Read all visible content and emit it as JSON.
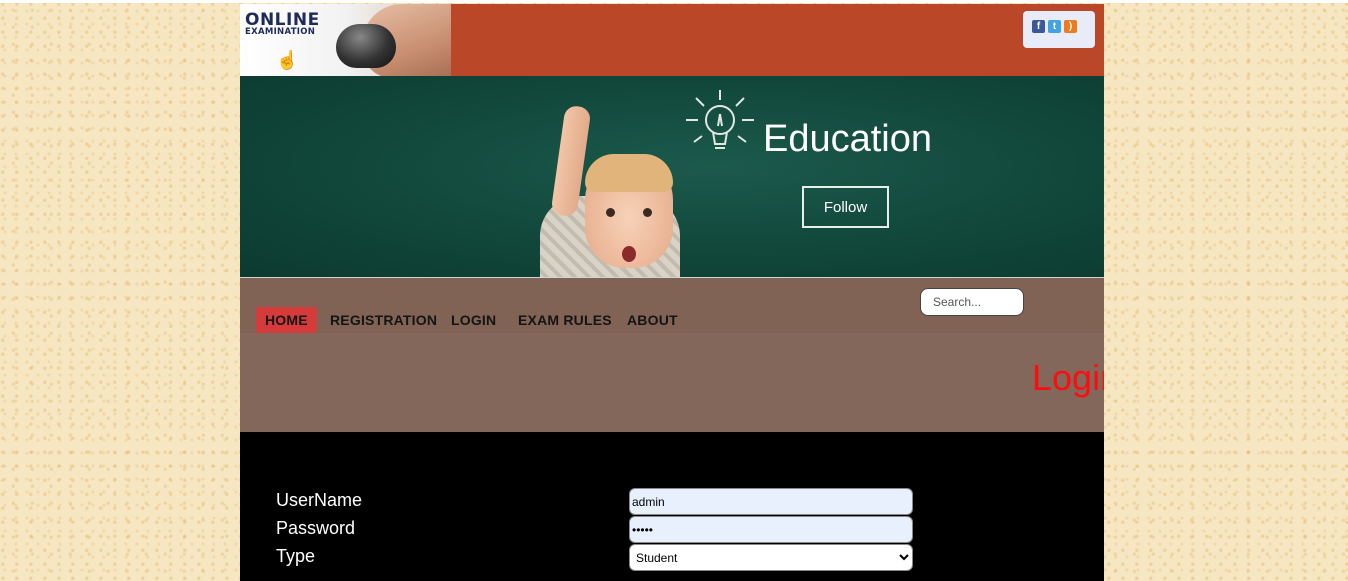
{
  "header": {
    "logo_line1": "ONLINE",
    "logo_line2": "EXAMINATION",
    "social": [
      "f",
      "t",
      "rss"
    ]
  },
  "banner": {
    "title": "Education",
    "follow_label": "Follow"
  },
  "nav": {
    "items": [
      {
        "label": "HOME",
        "active": true
      },
      {
        "label": "REGISTRATION",
        "active": false
      },
      {
        "label": "LOGIN",
        "active": false
      },
      {
        "label": "EXAM RULES",
        "active": false
      },
      {
        "label": "ABOUT",
        "active": false
      }
    ],
    "search_placeholder": "Search..."
  },
  "page_title": "Login",
  "form": {
    "username_label": "UserName",
    "username_value": "admin",
    "password_label": "Password",
    "password_value": "admin",
    "type_label": "Type",
    "type_selected": "Student"
  },
  "colors": {
    "background": "#f6e6c2",
    "header": "#b94728",
    "banner": "#11473b",
    "nav": "#806354",
    "active_nav": "#d63b3b",
    "title_band": "#83675a",
    "login_title": "#ff0d0d"
  },
  "icons": [
    "facebook-icon",
    "twitter-icon",
    "rss-icon",
    "cursor-hand-icon",
    "light-bulb-icon",
    "chevron-down-icon"
  ]
}
